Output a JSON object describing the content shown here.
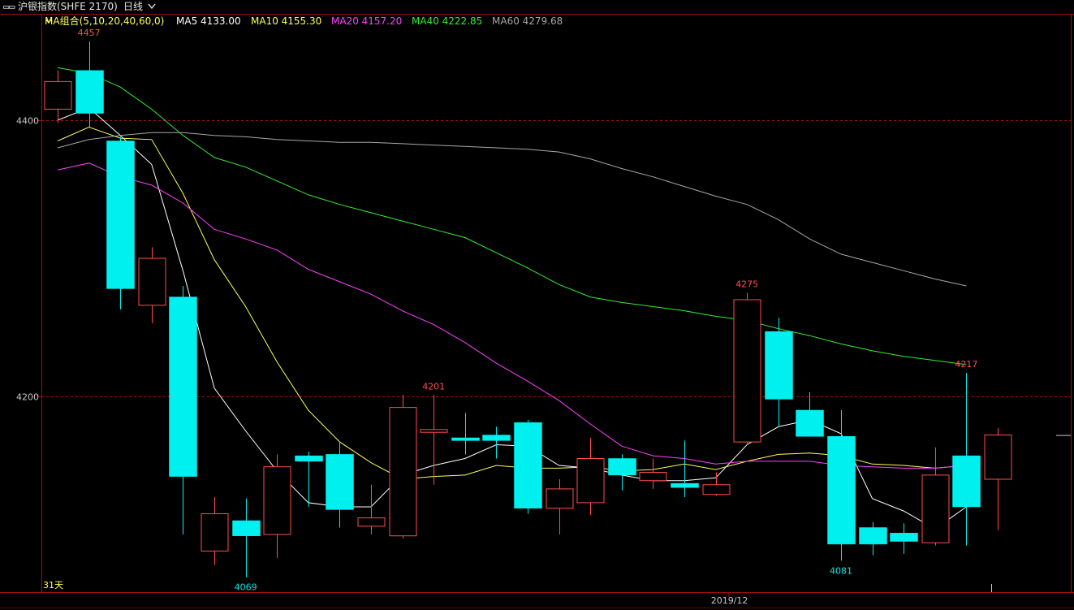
{
  "header": {
    "indicator_glyph": "▭▭",
    "instrument": "沪银指数(SHFE 2170)",
    "period": "日线",
    "period_chevron": "chevron-down-icon"
  },
  "ma_legend": {
    "group_label": "MA组合(5,10,20,40,60,0)",
    "items": [
      {
        "label": "MA5 4133.00",
        "color": "#ffffff"
      },
      {
        "label": "MA10 4155.30",
        "color": "#ffff55"
      },
      {
        "label": "MA20 4157.20",
        "color": "#ff40ff"
      },
      {
        "label": "MA40 4222.85",
        "color": "#33ee33"
      },
      {
        "label": "MA60 4279.68",
        "color": "#a8a8a8"
      }
    ]
  },
  "colors": {
    "up": "#ff4d4d",
    "down": "#00f0f0",
    "frame": "#a01010",
    "grid": "#a01010",
    "ma_group": "#ffff55"
  },
  "chart_data": {
    "type": "candlestick",
    "ylim": [
      4050,
      4480
    ],
    "y_ticks": [
      4200,
      4400
    ],
    "x_label": "2019/12",
    "x_label_index": 21,
    "bottom_left_label": "31天",
    "annotations": [
      {
        "text": "4457",
        "index": 1,
        "value": 4457,
        "kind": "high"
      },
      {
        "text": "4069",
        "index": 6,
        "value": 4069,
        "kind": "low"
      },
      {
        "text": "4201",
        "index": 12,
        "value": 4201,
        "kind": "high"
      },
      {
        "text": "4275",
        "index": 22,
        "value": 4275,
        "kind": "high"
      },
      {
        "text": "4081",
        "index": 25,
        "value": 4081,
        "kind": "low"
      },
      {
        "text": "4217",
        "index": 29,
        "value": 4217,
        "kind": "high"
      }
    ],
    "candles": [
      {
        "o": 4408,
        "h": 4436,
        "l": 4398,
        "c": 4428
      },
      {
        "o": 4436,
        "h": 4457,
        "l": 4395,
        "c": 4405
      },
      {
        "o": 4385,
        "h": 4388,
        "l": 4263,
        "c": 4278
      },
      {
        "o": 4266,
        "h": 4308,
        "l": 4253,
        "c": 4300
      },
      {
        "o": 4272,
        "h": 4280,
        "l": 4100,
        "c": 4142
      },
      {
        "o": 4088,
        "h": 4127,
        "l": 4078,
        "c": 4115
      },
      {
        "o": 4110,
        "h": 4126,
        "l": 4069,
        "c": 4099
      },
      {
        "o": 4100,
        "h": 4158,
        "l": 4083,
        "c": 4149
      },
      {
        "o": 4157,
        "h": 4160,
        "l": 4120,
        "c": 4153
      },
      {
        "o": 4158,
        "h": 4167,
        "l": 4105,
        "c": 4118
      },
      {
        "o": 4106,
        "h": 4136,
        "l": 4100,
        "c": 4112
      },
      {
        "o": 4099,
        "h": 4201,
        "l": 4097,
        "c": 4192
      },
      {
        "o": 4174,
        "h": 4201,
        "l": 4136,
        "c": 4176
      },
      {
        "o": 4170,
        "h": 4188,
        "l": 4158,
        "c": 4168
      },
      {
        "o": 4172,
        "h": 4178,
        "l": 4155,
        "c": 4168
      },
      {
        "o": 4181,
        "h": 4183,
        "l": 4115,
        "c": 4119
      },
      {
        "o": 4119,
        "h": 4140,
        "l": 4100,
        "c": 4133
      },
      {
        "o": 4123,
        "h": 4170,
        "l": 4114,
        "c": 4155
      },
      {
        "o": 4155,
        "h": 4158,
        "l": 4132,
        "c": 4143
      },
      {
        "o": 4139,
        "h": 4155,
        "l": 4133,
        "c": 4145
      },
      {
        "o": 4137,
        "h": 4168,
        "l": 4127,
        "c": 4134
      },
      {
        "o": 4129,
        "h": 4145,
        "l": 4128,
        "c": 4136
      },
      {
        "o": 4167,
        "h": 4275,
        "l": 4165,
        "c": 4270
      },
      {
        "o": 4247,
        "h": 4257,
        "l": 4178,
        "c": 4198
      },
      {
        "o": 4190,
        "h": 4203,
        "l": 4172,
        "c": 4171
      },
      {
        "o": 4171,
        "h": 4190,
        "l": 4081,
        "c": 4093
      },
      {
        "o": 4105,
        "h": 4109,
        "l": 4085,
        "c": 4093
      },
      {
        "o": 4101,
        "h": 4108,
        "l": 4086,
        "c": 4095
      },
      {
        "o": 4094,
        "h": 4163,
        "l": 4092,
        "c": 4143
      },
      {
        "o": 4157,
        "h": 4217,
        "l": 4092,
        "c": 4120
      },
      {
        "o": 4140,
        "h": 4177,
        "l": 4103,
        "c": 4172
      }
    ],
    "series": [
      {
        "name": "MA5",
        "color": "#ffffff",
        "values": [
          4400,
          4409,
          4389,
          4368,
          4291,
          4206,
          4175,
          4146,
          4123,
          4120,
          4120,
          4143,
          4150,
          4155,
          4165,
          4164,
          4150,
          4148,
          4143,
          4139,
          4139,
          4141,
          4165,
          4178,
          4183,
          4173,
          4126,
          4117,
          4104,
          4120,
          null
        ]
      },
      {
        "name": "MA10",
        "color": "#ffff55",
        "values": [
          4385,
          4395,
          4387,
          4386,
          4347,
          4299,
          4265,
          4225,
          4190,
          4167,
          4152,
          4140,
          4142,
          4143,
          4150,
          4148,
          4148,
          4149,
          4146,
          4147,
          4151,
          4147,
          4153,
          4158,
          4159,
          4157,
          4151,
          4150,
          4148,
          4150,
          null
        ]
      },
      {
        "name": "MA20",
        "color": "#ff40ff",
        "values": [
          4364,
          4369,
          4359,
          4353,
          4340,
          4321,
          4314,
          4306,
          4292,
          4283,
          4274,
          4262,
          4252,
          4239,
          4224,
          4211,
          4197,
          4180,
          4164,
          4157,
          4155,
          4151,
          4153,
          4153,
          4153,
          4150,
          4149,
          4148,
          4148,
          4150,
          null
        ]
      },
      {
        "name": "MA40",
        "color": "#33ee33",
        "values": [
          4438,
          4434,
          4424,
          4408,
          4389,
          4373,
          4366,
          4356,
          4346,
          4339,
          4333,
          4327,
          4321,
          4315,
          4304,
          4293,
          4281,
          4272,
          4268,
          4265,
          4262,
          4258,
          4255,
          4249,
          4244,
          4238,
          4233,
          4229,
          4226,
          4223,
          null
        ]
      },
      {
        "name": "MA60",
        "color": "#a8a8a8",
        "values": [
          4380,
          4386,
          4389,
          4391,
          4391,
          4389,
          4388,
          4386,
          4385,
          4384,
          4384,
          4383,
          4382,
          4381,
          4380,
          4379,
          4377,
          4372,
          4365,
          4359,
          4352,
          4345,
          4339,
          4328,
          4314,
          4303,
          4297,
          4291,
          4285,
          4280,
          null
        ]
      }
    ]
  }
}
